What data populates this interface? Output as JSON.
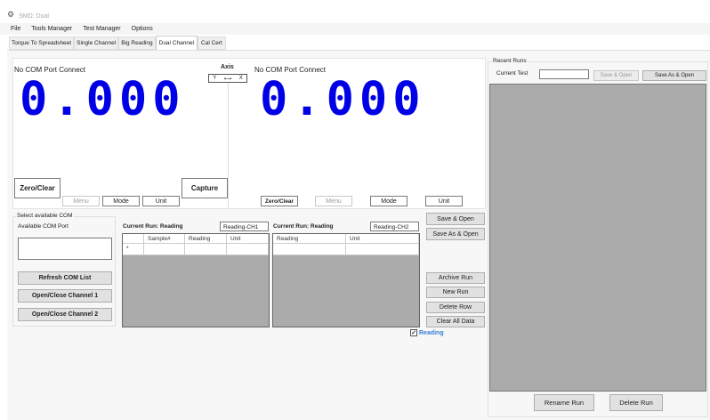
{
  "window": {
    "title": "SMD: Dual"
  },
  "menu": [
    "File",
    "Tools Manager",
    "Test Manager",
    "Options"
  ],
  "tabs": [
    "Torque To Spreadsheet",
    "Single Channel",
    "Big Reading",
    "Dual Channel",
    "Cal Cert"
  ],
  "active_tab": "Dual Channel",
  "channel1": {
    "status": "No COM Port Connect",
    "reading": "0.000",
    "zero": "Zero/Clear",
    "capture": "Capture",
    "menu": "Menu",
    "mode": "Mode",
    "unit": "Unit"
  },
  "axis": {
    "label": "Axis",
    "y": "Y",
    "arrow": "⟷",
    "x": "X"
  },
  "channel2": {
    "status": "No COM Port Connect",
    "reading": "0.000",
    "zero": "Zero/Clear",
    "menu": "Menu",
    "mode": "Mode",
    "unit": "Unit"
  },
  "com": {
    "group": "Select available COM",
    "label": "Available COM Port",
    "refresh": "Refresh COM List",
    "ch1": "Open/Close Channel 1",
    "ch2": "Open/Close Channel 2"
  },
  "grid1": {
    "title": "Current Run: Reading",
    "name": "Reading-CH1",
    "columns": [
      "Sample#",
      "Reading",
      "Unit"
    ],
    "row_marker": "*"
  },
  "grid2": {
    "title": "Current Run: Reading",
    "name": "Reading-CH2",
    "columns": [
      "Reading",
      "Unit"
    ]
  },
  "actions": {
    "save_open": "Save & Open",
    "save_as_open": "Save As & Open",
    "archive": "Archive Run",
    "new": "New Run",
    "delete_row": "Delete Row",
    "clear": "Clear All Data",
    "reading_check": "Reading"
  },
  "recent": {
    "group": "Recent Runs",
    "current_test": "Current Test",
    "current_test_value": "",
    "save_open": "Save & Open",
    "save_as_open": "Save As & Open",
    "rename": "Rename Run",
    "delete": "Delete Run"
  }
}
